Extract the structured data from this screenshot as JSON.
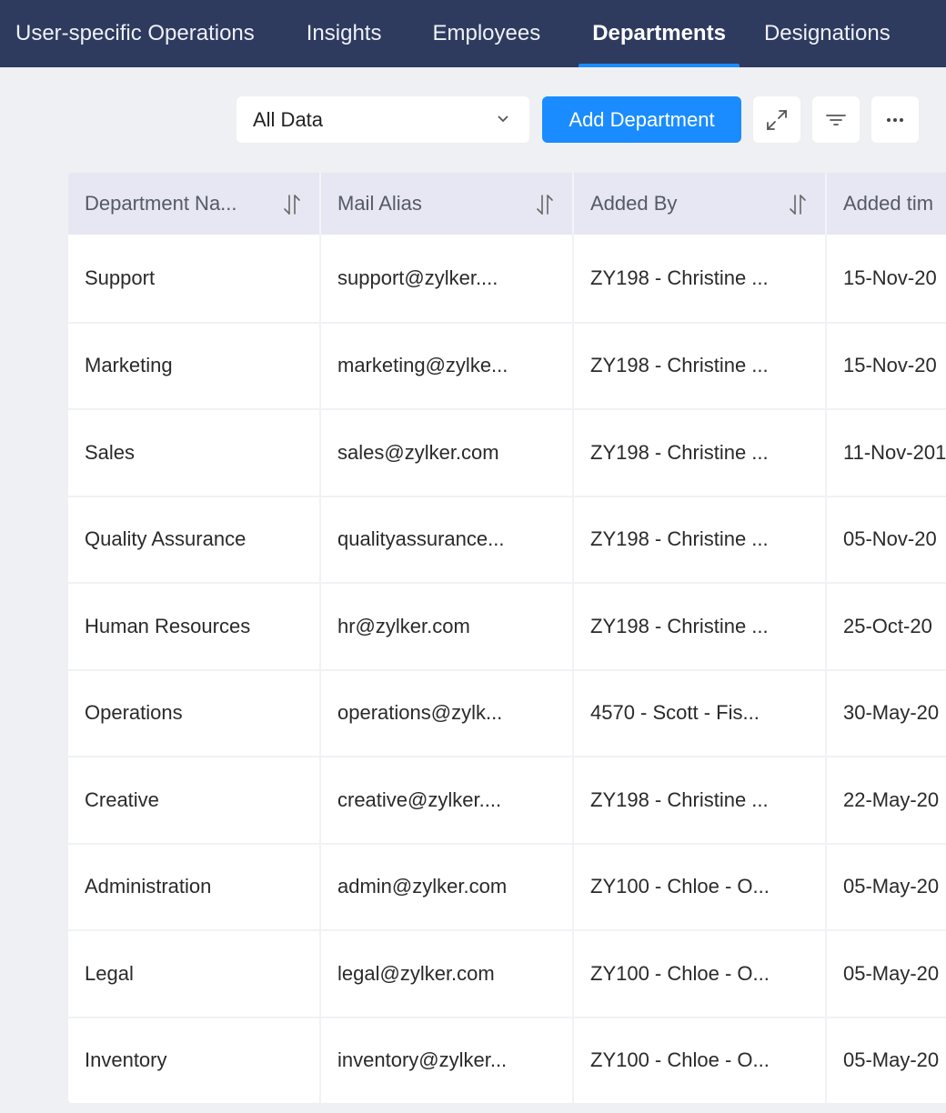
{
  "nav": {
    "tabs": [
      {
        "label": "User-specific Operations",
        "active": false
      },
      {
        "label": "Insights",
        "active": false
      },
      {
        "label": "Employees",
        "active": false
      },
      {
        "label": "Departments",
        "active": true
      },
      {
        "label": "Designations",
        "active": false
      }
    ]
  },
  "toolbar": {
    "view_select": {
      "value": "All Data",
      "icon": "chevron-down-icon"
    },
    "add_button_label": "Add Department",
    "icons": [
      "expand-icon",
      "filter-icon",
      "more-options-icon"
    ]
  },
  "colors": {
    "nav_bg": "#2e3a5e",
    "accent": "#1a8cff",
    "page_bg": "#eff0f3",
    "header_bg": "#e6e7f2"
  },
  "table": {
    "columns": [
      {
        "label": "Department Na...",
        "sortable": true
      },
      {
        "label": "Mail Alias",
        "sortable": true
      },
      {
        "label": "Added By",
        "sortable": true
      },
      {
        "label": "Added tim",
        "sortable": false
      }
    ],
    "rows": [
      [
        "Support",
        "support@zylker....",
        "ZY198 - Christine ...",
        "15-Nov-20"
      ],
      [
        "Marketing",
        "marketing@zylke...",
        "ZY198 - Christine ...",
        "15-Nov-20"
      ],
      [
        "Sales",
        "sales@zylker.com",
        "ZY198 - Christine ...",
        "11-Nov-201"
      ],
      [
        "Quality Assurance",
        "qualityassurance...",
        "ZY198 - Christine ...",
        "05-Nov-20"
      ],
      [
        "Human Resources",
        "hr@zylker.com",
        "ZY198 - Christine ...",
        "25-Oct-20"
      ],
      [
        "Operations",
        "operations@zylk...",
        "4570 - Scott - Fis...",
        "30-May-20"
      ],
      [
        "Creative",
        "creative@zylker....",
        "ZY198 - Christine ...",
        "22-May-20"
      ],
      [
        "Administration",
        "admin@zylker.com",
        "ZY100 - Chloe - O...",
        "05-May-20"
      ],
      [
        "Legal",
        "legal@zylker.com",
        "ZY100 - Chloe - O...",
        "05-May-20"
      ],
      [
        "Inventory",
        "inventory@zylker...",
        "ZY100 - Chloe - O...",
        "05-May-20"
      ]
    ]
  }
}
